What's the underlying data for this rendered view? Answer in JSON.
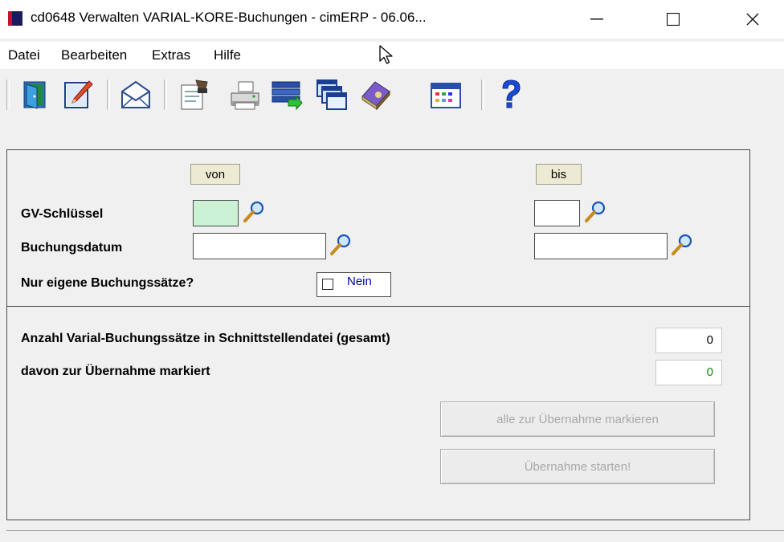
{
  "window": {
    "title": "cd0648 Verwalten VARIAL-KORE-Buchungen - cimERP - 06.06...",
    "controls": {
      "minimize": "—",
      "maximize": "☐",
      "close": "✕"
    }
  },
  "menu": [
    "Datei",
    "Bearbeiten",
    "Extras",
    "Hilfe"
  ],
  "toolbar_icons": [
    "exit-icon",
    "edit-icon",
    "mail-icon",
    "document-stamp-icon",
    "printer-icon",
    "table-import-icon",
    "windows-icon",
    "book-icon",
    "calendar-icon",
    "help-icon"
  ],
  "form": {
    "header_von": "von",
    "header_bis": "bis",
    "gv_label": "GV-Schlüssel",
    "gv_von": "",
    "gv_bis": "",
    "datum_label": "Buchungsdatum",
    "datum_von": "",
    "datum_bis": "",
    "eigene_label": "Nur eigene Buchungssätze?",
    "eigene_value": "Nein",
    "eigene_checked": false
  },
  "summary": {
    "anzahl_label": "Anzahl Varial-Buchungssätze in Schnittstellendatei (gesamt)",
    "anzahl_value": "0",
    "davon_label": "davon zur Übernahme markiert",
    "davon_value": "0",
    "markall_label": "alle zur Übernahme markieren",
    "start_label": "Übernahme starten!"
  },
  "colors": {
    "gv_field_bg": "#ccf2d6",
    "header_bg": "#ecead2",
    "checkbox_text": "#0000aa",
    "marked_count": "#0a8a0a",
    "app_icon_red": "#c8102e",
    "app_icon_navy": "#1a1a5e"
  }
}
